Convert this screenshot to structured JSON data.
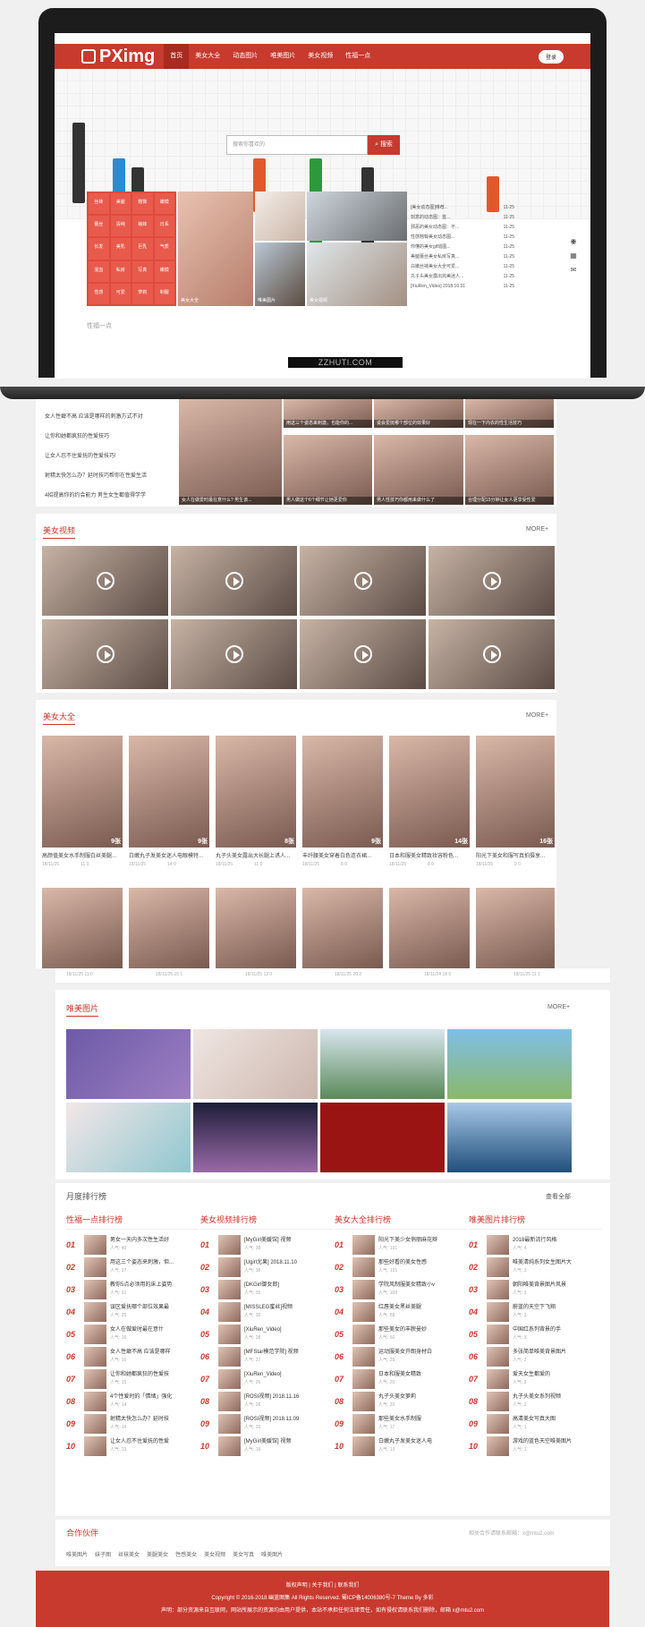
{
  "device_caption": "ZZHUTI.COM",
  "header": {
    "logo": "PXimg",
    "menu": [
      "首页",
      "美女大全",
      "动态图片",
      "唯美图片",
      "美女视频",
      "性福一点"
    ],
    "login": "登录"
  },
  "hero": {
    "search_placeholder": "搜索你喜欢的",
    "search_button": "搜索"
  },
  "tags": [
    "丝袜",
    "美腿",
    "翘臀",
    "嫩模",
    "蕾丝",
    "清纯",
    "萌妹",
    "日系",
    "长发",
    "美乳",
    "巨乳",
    "气质",
    "混血",
    "私房",
    "写真",
    "嫩模",
    "性感",
    "可爱",
    "萝莉",
    "制服"
  ],
  "featured": [
    "美女大全",
    "唯美图片",
    "美女视频"
  ],
  "news": [
    [
      "[美女动态图]推荐...",
      "11-25"
    ],
    [
      "刻意的动态图：首...",
      "11-25"
    ],
    [
      "邪恶的美女动态图：不...",
      "11-25"
    ],
    [
      "性感翘臀美女动态图...",
      "11-25"
    ],
    [
      "你懂的美女gif动图...",
      "11-25"
    ],
    [
      "美腿蕾丝美女私房写真...",
      "11-25"
    ],
    [
      "白嫩丝袜美女大全可爱...",
      "11-25"
    ],
    [
      "丸子头美女露出完美迷人...",
      "11-25"
    ],
    [
      "[XiuRen_Video] 2018.10.31",
      "11-25"
    ]
  ],
  "section_peek": "性福一点",
  "xingfu": {
    "items": [
      "女人性癖不高 应该是哪样的刺激方式不对",
      "让你和她都疯狂的性爱技巧",
      "让女人忍不住爱抚的性爱技巧!",
      "射精太快怎么办？延时技巧帮你在性爱生活",
      "4招提高你的约会能力 男生女生都值得学学"
    ],
    "captions": [
      "用这三个姿态来刺激，也能你的...",
      "说会爱抚哪个部位的效果好",
      "现在一下内衣的性生活技巧",
      "女人在做爱时最在意什么? 男生该...",
      "男人做这个6个细节让她更爱你",
      "男人性技巧你都用来做什么了",
      "合理分配15分钟让女人更享受性爱"
    ]
  },
  "videos": {
    "title": "美女视频",
    "more": "MORE+"
  },
  "gallery": {
    "title": "美女大全",
    "more": "MORE+",
    "row1": [
      {
        "title": "高颜值美女水手制服白丝美腿...",
        "date": "18/11/25",
        "counts": "11 0",
        "pics": "9张"
      },
      {
        "title": "白嫩丸子发美女迷人电眼模特...",
        "date": "18/11/25",
        "counts": "14 0",
        "pics": "9张"
      },
      {
        "title": "丸子头美女露出大长腿上诱人...",
        "date": "18/11/25",
        "counts": "11 0",
        "pics": "8张"
      },
      {
        "title": "丰纤腰美女穿着白色连衣裙...",
        "date": "18/11/25",
        "counts": "8 0",
        "pics": "9张"
      },
      {
        "title": "日本和服美女精致妆容粉色...",
        "date": "18/11/25",
        "counts": "8 0",
        "pics": "14张"
      },
      {
        "title": "阳光下美女和服写真拍摄享...",
        "date": "18/11/25",
        "counts": "9 0",
        "pics": "16张"
      }
    ],
    "row2_meta": [
      "18/11/25  11  0",
      "18/11/25  15  1",
      "18/11/25  12  0",
      "18/11/25  20  2",
      "18/11/24  18  0",
      "18/11/25  11  1"
    ]
  },
  "weimei": {
    "title": "唯美图片",
    "more": "MORE+"
  },
  "ranking": {
    "title": "月度排行榜",
    "view_all": "查看全部",
    "columns": [
      {
        "head": "性福一点排行榜",
        "rows": [
          [
            "男女一天内多次性生活好",
            "人气: 40"
          ],
          [
            "用这三个姿态来刺激，但...",
            "人气: 37"
          ],
          [
            "教你5点必须用的床上姿势",
            "人气: 31"
          ],
          [
            "误区爱抚哪个部位效果最",
            "人气: 25"
          ],
          [
            "女人在做爱时最在意什",
            "人气: 16"
          ],
          [
            "女人性癖不高 应该是哪样",
            "人气: 16"
          ],
          [
            "让你和她都疯狂的性爱技",
            "人气: 15"
          ],
          [
            "4个性爱时的「情绪」强化",
            "人气: 14"
          ],
          [
            "射精太快怎么办？延时技",
            "人气: 14"
          ],
          [
            "让女人忍不住爱抚的性爱",
            "人气: 13"
          ]
        ]
      },
      {
        "head": "美女视频排行榜",
        "rows": [
          [
            "[MyGirl美媛馆] 视频",
            "人气: 38"
          ],
          [
            "[Ugirl尤果] 2018.11.10",
            "人气: 38"
          ],
          [
            "[DKGirl御女郎]",
            "人气: 35"
          ],
          [
            "[MISSLEG蜜丝]视频",
            "人气: 30"
          ],
          [
            "[XiuRen_Video]",
            "人气: 28"
          ],
          [
            "[MFStar模范学院] 视频",
            "人气: 27"
          ],
          [
            "[XiuRen_Video]",
            "人气: 26"
          ],
          [
            "[ROSI视频] 2018.11.16",
            "人气: 26"
          ],
          [
            "[ROSI视频] 2018.11.09",
            "人气: 20"
          ],
          [
            "[MyGirl美媛馆] 视频",
            "人气: 19"
          ]
        ]
      },
      {
        "head": "美女大全排行榜",
        "rows": [
          [
            "阳光下美少女俏丽麻花辫",
            "人气: 191"
          ],
          [
            "那些好看的美女性感",
            "人气: 131"
          ],
          [
            "学院风制服美女精致小v",
            "人气: 108"
          ],
          [
            "红唇美女黑丝美腿",
            "人气: 58"
          ],
          [
            "那些美女的丰腴曼妙",
            "人气: 50"
          ],
          [
            "运动服美女开朗身材白",
            "人气: 29"
          ],
          [
            "日本和服美女精致",
            "人气: 20"
          ],
          [
            "丸子头美女萝莉",
            "人气: 20"
          ],
          [
            "那些美女水手制服",
            "人气: 17"
          ],
          [
            "白嫩丸子发美女迷人电",
            "人气: 13"
          ]
        ]
      },
      {
        "head": "唯美图片排行榜",
        "rows": [
          [
            "2018最新流行风格",
            "人气: 4"
          ],
          [
            "唯美清纯系列女生图片大",
            "人气: 3"
          ],
          [
            "朝阳唯美背景图片风景",
            "人气: 3"
          ],
          [
            "蔚蓝的天空下飞翔",
            "人气: 3"
          ],
          [
            "中国红系列背景的手",
            "人气: 3"
          ],
          [
            "多张简单唯美背景图片",
            "人气: 2"
          ],
          [
            "爱天女生都爱的",
            "人气: 2"
          ],
          [
            "丸子头美女系列视频",
            "人气: 2"
          ],
          [
            "高清美女写真大图",
            "人气: 1"
          ],
          [
            "游戏的蓝色天空唯美图片",
            "人气: 1"
          ]
        ]
      }
    ]
  },
  "partners": {
    "title": "合作伙伴",
    "note": "相关合作请联系邮箱：x@mtu2.com",
    "links": [
      "唯美图片",
      "妹子图",
      "丝袜美女",
      "美腿美女",
      "性感美女",
      "美女视频",
      "美女写真",
      "唯美图片"
    ]
  },
  "footer": {
    "links": "版权声明 | 关于我们 | 联系我们",
    "copyright": "Copyright © 2016-2018 幽蓝图集 All Rights Reserved. 蜀ICP备14006380号-7 Theme By 多彩",
    "disclaimer": "声明：部分资源来自互联网，网站所展示的资源均由用户提供，本站不承担任何法律责任，如有侵权请联系我们删除，邮箱 x@mtu2.com"
  }
}
